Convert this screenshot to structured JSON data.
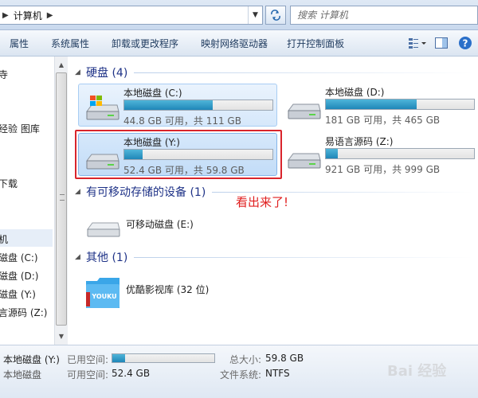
{
  "address": {
    "crumb": "计算机"
  },
  "search": {
    "placeholder": "搜索 计算机"
  },
  "toolbar": {
    "items": [
      "属性",
      "系统属性",
      "卸载或更改程序",
      "映射网络驱动器",
      "打开控制面板"
    ]
  },
  "nav": {
    "items": [
      "寺",
      "经验 图库",
      "下载",
      "机",
      "磁盘 (C:)",
      "磁盘 (D:)",
      "磁盘 (Y:)",
      "言源码 (Z:)"
    ]
  },
  "groups": {
    "hdd": {
      "title": "硬盘 (4)"
    },
    "removable": {
      "title": "有可移动存储的设备 (1)"
    },
    "other": {
      "title": "其他 (1)"
    }
  },
  "drives": [
    {
      "name": "本地磁盘 (C:)",
      "info": "44.8 GB 可用，共 111 GB",
      "used_fraction": 0.596,
      "os": true
    },
    {
      "name": "本地磁盘 (D:)",
      "info": "181 GB 可用，共 465 GB",
      "used_fraction": 0.611,
      "os": false
    },
    {
      "name": "本地磁盘 (Y:)",
      "info": "52.4 GB 可用，共 59.8 GB",
      "used_fraction": 0.124,
      "os": false
    },
    {
      "name": "易语言源码 (Z:)",
      "info": "921 GB 可用，共 999 GB",
      "used_fraction": 0.078,
      "os": false
    }
  ],
  "removable_drive": {
    "name": "可移动磁盘 (E:)"
  },
  "other_item": {
    "name": "优酷影视库 (32 位)",
    "logo_text": "YOUKU"
  },
  "annotation": "看出来了!",
  "details": {
    "name": "本地磁盘 (Y:)",
    "type": "本地磁盘",
    "used_label": "已用空间:",
    "used_fraction": 0.124,
    "free_label": "可用空间:",
    "free_value": "52.4 GB",
    "total_label": "总大小:",
    "total_value": "59.8 GB",
    "fs_label": "文件系统:",
    "fs_value": "NTFS"
  },
  "watermark": "Bai 经验",
  "colors": {
    "accent": "#1e3287",
    "bar": "#1f86b8",
    "highlight": "#d9242c"
  }
}
